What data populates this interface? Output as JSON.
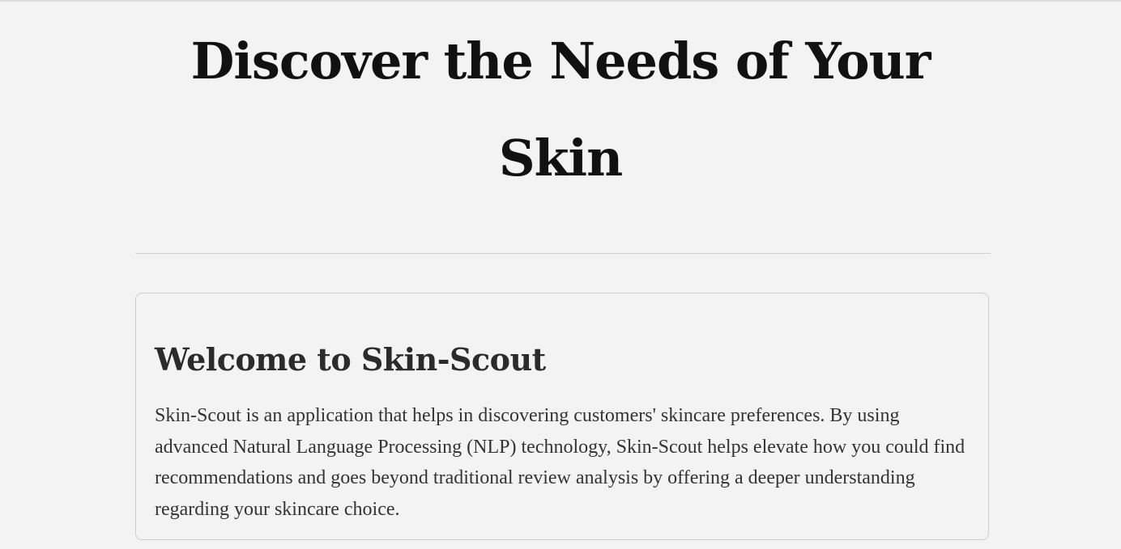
{
  "hero": {
    "title": "Discover the Needs of Your Skin"
  },
  "welcome": {
    "heading": "Welcome to Skin-Scout",
    "body": "Skin-Scout is an application that helps in discovering customers' skincare preferences. By using advanced Natural Language Processing (NLP) technology, Skin-Scout helps elevate how you could find recommendations and goes beyond traditional review analysis by offering a deeper understanding regarding your skincare choice."
  },
  "colors": {
    "background": "#f3f3f3",
    "title_text": "#111111",
    "body_text": "#333333",
    "border": "#cfcfcf"
  }
}
